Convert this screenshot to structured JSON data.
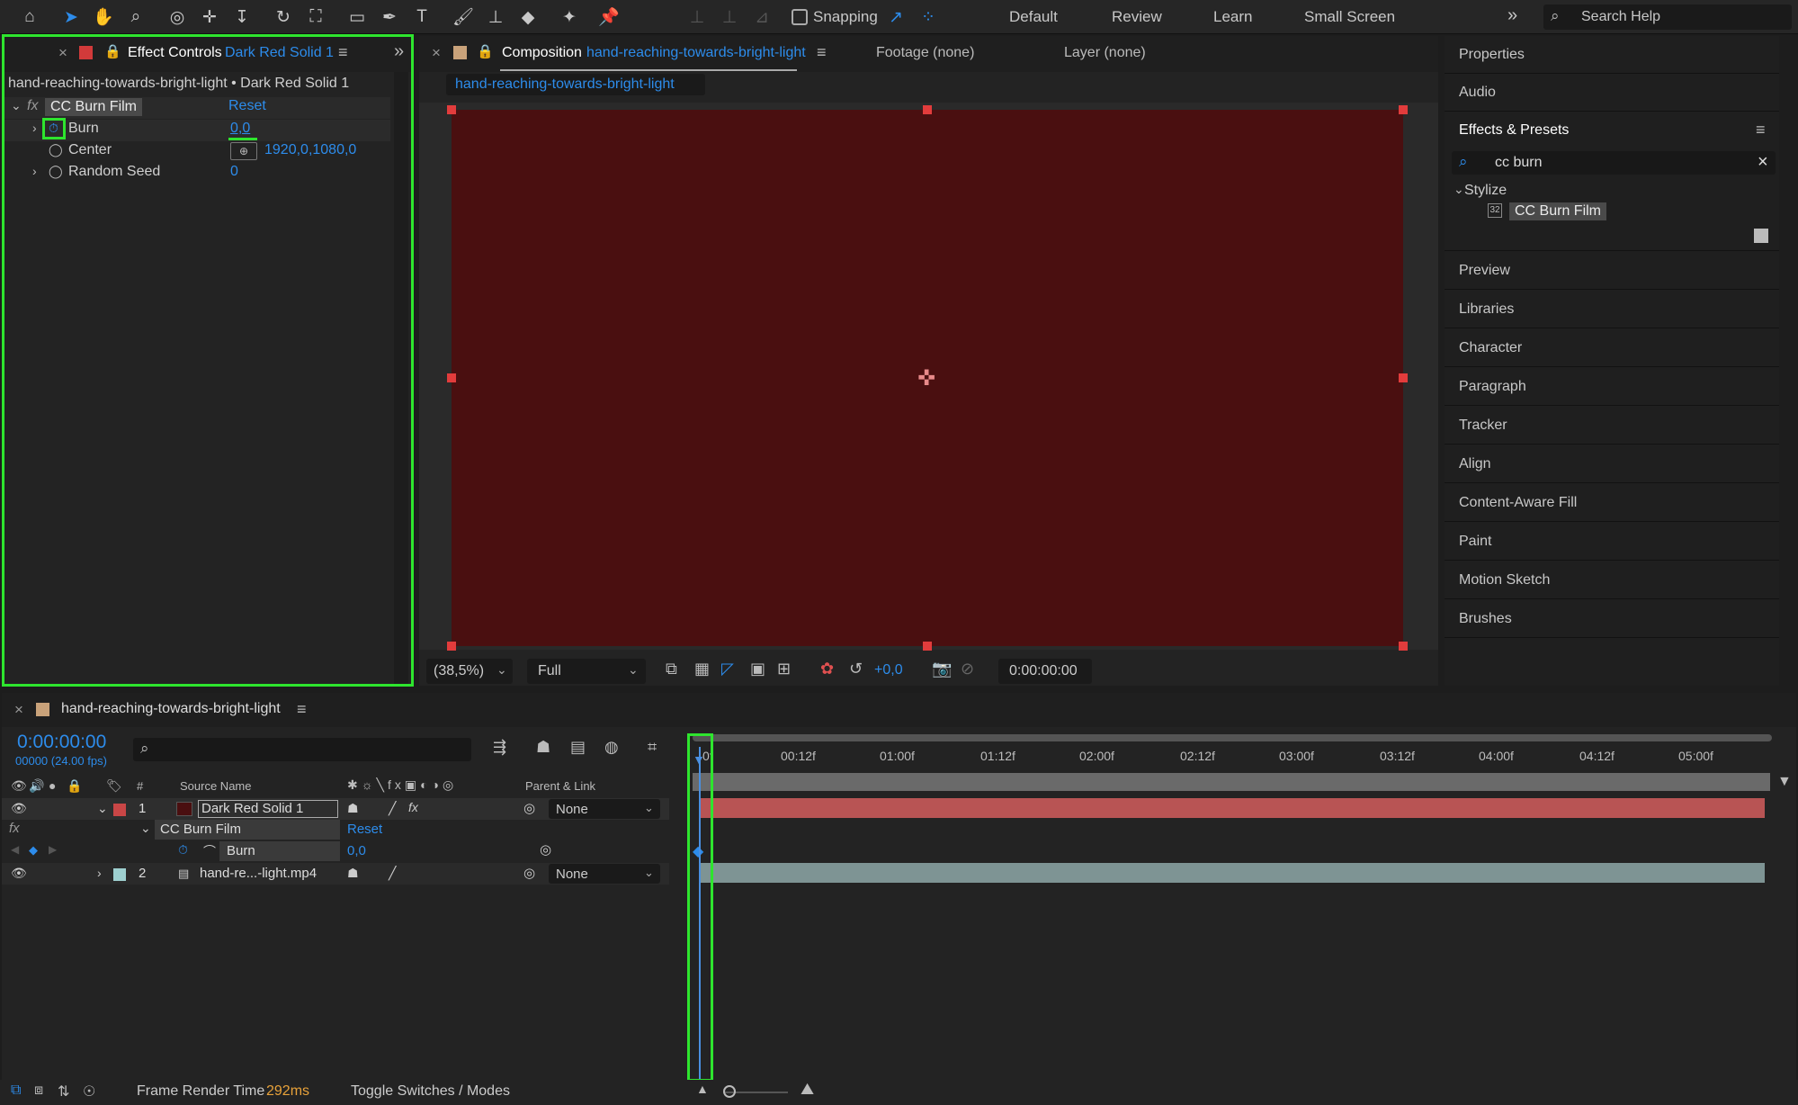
{
  "toolbar": {
    "snapping_label": "Snapping",
    "workspaces": [
      "Default",
      "Review",
      "Learn",
      "Small Screen"
    ],
    "search_placeholder": "Search Help",
    "more_label": "»"
  },
  "effect_controls": {
    "tab_prefix": "Effect Controls",
    "tab_layer": "Dark Red Solid 1",
    "breadcrumb": "hand-reaching-towards-bright-light • Dark Red Solid 1",
    "effect_name": "CC Burn Film",
    "reset_label": "Reset",
    "props": [
      {
        "name": "Burn",
        "value": "0,0"
      },
      {
        "name": "Center",
        "value": "1920,0,1080,0"
      },
      {
        "name": "Random Seed",
        "value": "0"
      }
    ]
  },
  "composition": {
    "tab_prefix": "Composition",
    "tab_name": "hand-reaching-towards-bright-light",
    "footage_tab": "Footage (none)",
    "layer_tab": "Layer (none)",
    "comp_chip": "hand-reaching-towards-bright-light",
    "zoom": "(38,5%)",
    "resolution": "Full",
    "exposure": "+0,0",
    "timecode": "0:00:00:00",
    "canvas_color": "#4a0f10"
  },
  "right_panel": {
    "items_top": [
      "Properties",
      "Audio"
    ],
    "effects_title": "Effects & Presets",
    "search_value": "cc burn",
    "category": "Stylize",
    "result": "CC Burn Film",
    "items_bottom": [
      "Preview",
      "Libraries",
      "Character",
      "Paragraph",
      "Tracker",
      "Align",
      "Content-Aware Fill",
      "Paint",
      "Motion Sketch",
      "Brushes"
    ]
  },
  "timeline": {
    "comp_name": "hand-reaching-towards-bright-light",
    "timecode": "0:00:00:00",
    "frames": "00000 (24.00 fps)",
    "col_hash": "#",
    "col_source": "Source Name",
    "col_parent": "Parent & Link",
    "ruler": [
      "0f",
      "00:12f",
      "01:00f",
      "01:12f",
      "02:00f",
      "02:12f",
      "03:00f",
      "03:12f",
      "04:00f",
      "04:12f",
      "05:00f"
    ],
    "layers": [
      {
        "num": "1",
        "name": "Dark Red Solid 1",
        "parent": "None",
        "label_color": "#c94646"
      },
      {
        "num": "2",
        "name": "hand-re...-light.mp4",
        "parent": "None",
        "label_color": "#9ed0d0"
      }
    ],
    "effect_name": "CC Burn Film",
    "reset_label": "Reset",
    "burn_label": "Burn",
    "burn_value": "0,0"
  },
  "status": {
    "render_label": "Frame Render Time",
    "render_value": "292ms",
    "toggle_label": "Toggle Switches / Modes"
  }
}
